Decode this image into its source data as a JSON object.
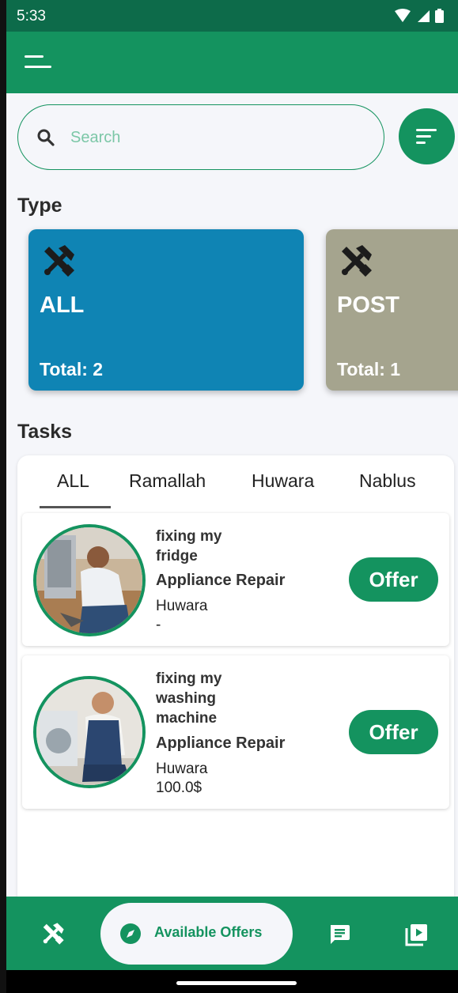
{
  "status_bar": {
    "time": "5:33"
  },
  "search": {
    "placeholder": "Search"
  },
  "sections": {
    "type_title": "Type",
    "tasks_title": "Tasks"
  },
  "type_cards": [
    {
      "name": "ALL",
      "total": "Total: 2",
      "color": "#0f84b4"
    },
    {
      "name": "POST",
      "total": "Total: 1",
      "color": "#a5a48e"
    }
  ],
  "tabs": [
    "ALL",
    "Ramallah",
    "Huwara",
    "Nablus"
  ],
  "active_tab": "ALL",
  "tasks": [
    {
      "title": "fixing my fridge",
      "category": "Appliance Repair",
      "location": "Huwara",
      "price": "-",
      "action": "Offer"
    },
    {
      "title": "fixing my washing machine",
      "category": "Appliance Repair",
      "location": "Huwara",
      "price": "100.0$",
      "action": "Offer"
    }
  ],
  "bottom_nav": {
    "active_label": "Available Offers"
  },
  "colors": {
    "primary": "#14935f",
    "status_bar": "#0d6b4a",
    "background": "#f5f6fa"
  }
}
